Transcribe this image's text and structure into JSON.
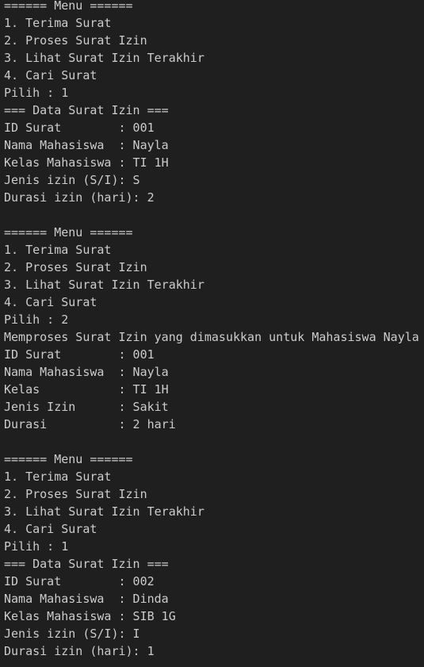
{
  "terminal": {
    "lines": [
      "====== Menu ======",
      "1. Terima Surat",
      "2. Proses Surat Izin",
      "3. Lihat Surat Izin Terakhir",
      "4. Cari Surat",
      "Pilih : 1",
      "=== Data Surat Izin ===",
      "ID Surat        : 001",
      "Nama Mahasiswa  : Nayla",
      "Kelas Mahasiswa : TI 1H",
      "Jenis izin (S/I): S",
      "Durasi izin (hari): 2",
      "",
      "====== Menu ======",
      "1. Terima Surat",
      "2. Proses Surat Izin",
      "3. Lihat Surat Izin Terakhir",
      "4. Cari Surat",
      "Pilih : 2",
      "Memproses Surat Izin yang dimasukkan untuk Mahasiswa Nayla",
      "ID Surat        : 001",
      "Nama Mahasiswa  : Nayla",
      "Kelas           : TI 1H",
      "Jenis Izin      : Sakit",
      "Durasi          : 2 hari",
      "",
      "====== Menu ======",
      "1. Terima Surat",
      "2. Proses Surat Izin",
      "3. Lihat Surat Izin Terakhir",
      "4. Cari Surat",
      "Pilih : 1",
      "=== Data Surat Izin ===",
      "ID Surat        : 002",
      "Nama Mahasiswa  : Dinda",
      "Kelas Mahasiswa : SIB 1G",
      "Jenis izin (S/I): I",
      "Durasi izin (hari): 1"
    ]
  }
}
